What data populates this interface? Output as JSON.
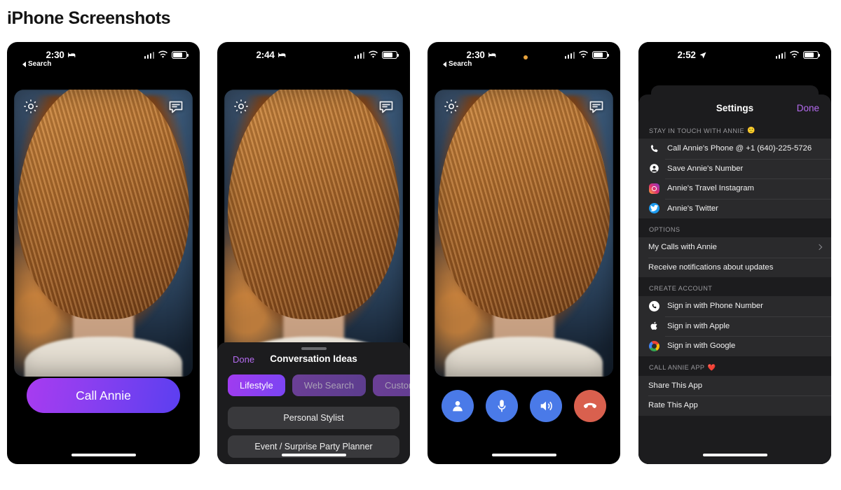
{
  "page": {
    "title": "iPhone Screenshots"
  },
  "phones": [
    {
      "id": "phone-1",
      "status": {
        "time": "2:30",
        "focus_icon": "bed-icon",
        "back_label": "Search",
        "signal_icon": "cellular-signal-icon",
        "wifi_icon": "wifi-icon",
        "battery_icon": "battery-icon"
      },
      "overlay": {
        "settings_icon": "gear-icon",
        "chat_icon": "message-bubble-icon"
      },
      "call_button": {
        "label": "Call Annie",
        "gradient_from": "#a83bf0",
        "gradient_to": "#5b3ff0"
      }
    },
    {
      "id": "phone-2",
      "status": {
        "time": "2:44",
        "focus_icon": "bed-icon",
        "back_label": "",
        "signal_icon": "cellular-signal-icon",
        "wifi_icon": "wifi-icon",
        "battery_icon": "battery-icon"
      },
      "overlay": {
        "settings_icon": "gear-icon",
        "chat_icon": "message-bubble-icon"
      },
      "sheet": {
        "done_label": "Done",
        "title": "Conversation Ideas",
        "done_color": "#b56bf0",
        "chips": [
          {
            "label": "Lifestyle",
            "active": true
          },
          {
            "label": "Web Search",
            "active": false
          },
          {
            "label": "Custom Prompt",
            "active": false
          }
        ],
        "ideas": [
          "Personal Stylist",
          "Event / Surprise Party Planner"
        ]
      }
    },
    {
      "id": "phone-3",
      "status": {
        "time": "2:30",
        "focus_icon": "bed-icon",
        "back_label": "Search",
        "privacy_dot": "microphone-in-use-indicator",
        "signal_icon": "cellular-signal-icon",
        "wifi_icon": "wifi-icon",
        "battery_icon": "battery-icon"
      },
      "overlay": {
        "settings_icon": "gear-icon",
        "chat_icon": "message-bubble-icon"
      },
      "call_controls": [
        {
          "name": "contact-button",
          "icon": "person-icon",
          "color": "#4a7ae8"
        },
        {
          "name": "mute-button",
          "icon": "microphone-icon",
          "color": "#4a7ae8"
        },
        {
          "name": "speaker-button",
          "icon": "speaker-icon",
          "color": "#4a7ae8"
        },
        {
          "name": "end-call-button",
          "icon": "end-call-icon",
          "color": "#d9604e"
        }
      ]
    },
    {
      "id": "phone-4",
      "status": {
        "time": "2:52",
        "focus_icon": "location-arrow-icon",
        "back_label": "",
        "signal_icon": "cellular-signal-icon",
        "wifi_icon": "wifi-icon",
        "battery_icon": "battery-icon"
      },
      "settings": {
        "title": "Settings",
        "done_label": "Done",
        "done_color": "#b56bf0",
        "sections": [
          {
            "header": "STAY IN TOUCH WITH ANNIE",
            "header_emoji": "🙂",
            "rows": [
              {
                "icon": "phone-handset-icon",
                "label": "Call Annie's Phone @ +1 (640)-225-5726"
              },
              {
                "icon": "person-circle-icon",
                "label": "Save Annie's Number"
              },
              {
                "icon": "instagram-icon",
                "label": "Annie's Travel Instagram"
              },
              {
                "icon": "twitter-icon",
                "label": "Annie's Twitter"
              }
            ]
          },
          {
            "header": "OPTIONS",
            "header_emoji": "",
            "rows": [
              {
                "icon": "",
                "label": "My Calls with Annie",
                "chevron": true
              },
              {
                "icon": "",
                "label": "Receive notifications about updates"
              }
            ]
          },
          {
            "header": "CREATE ACCOUNT",
            "header_emoji": "",
            "rows": [
              {
                "icon": "phone-circle-icon",
                "label": "Sign in with Phone Number"
              },
              {
                "icon": "apple-logo-icon",
                "label": "Sign in with Apple"
              },
              {
                "icon": "google-logo-icon",
                "label": "Sign in with Google"
              }
            ]
          },
          {
            "header": "CALL ANNIE APP",
            "header_emoji": "❤️",
            "rows": [
              {
                "icon": "",
                "label": "Share This App"
              },
              {
                "icon": "",
                "label": "Rate This App"
              }
            ]
          }
        ]
      }
    }
  ]
}
